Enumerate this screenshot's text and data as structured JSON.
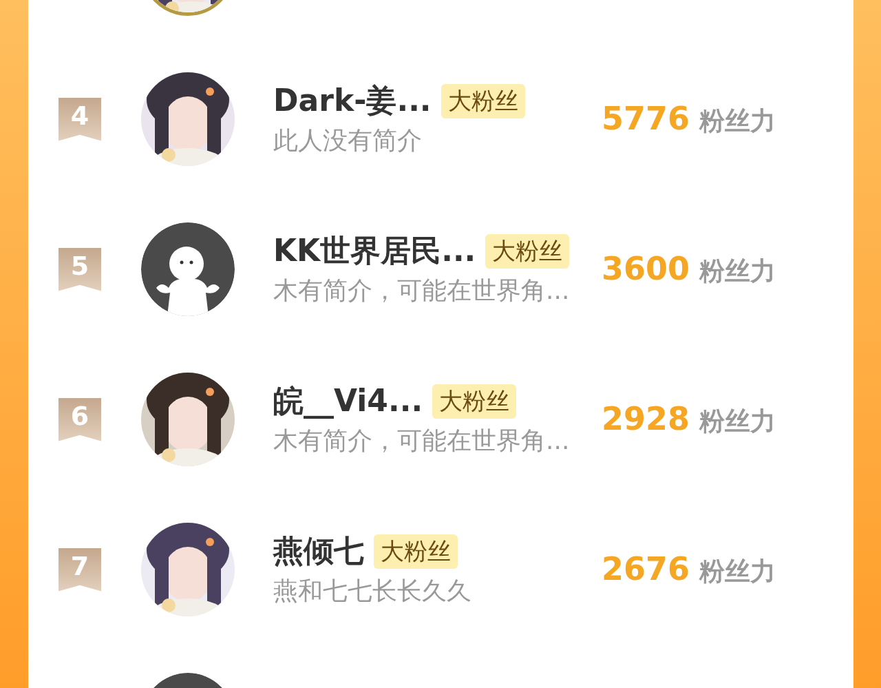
{
  "fans": [
    {
      "rank": "4",
      "name": "Dark-姜...",
      "tag": "大粉丝",
      "bio": "此人没有简介",
      "score": "5776",
      "score_unit": "粉丝力"
    },
    {
      "rank": "5",
      "name": "KK世界居民...",
      "tag": "大粉丝",
      "bio": "木有简介，可能在世界角...",
      "score": "3600",
      "score_unit": "粉丝力",
      "avatar": {
        "kind": "default"
      }
    },
    {
      "rank": "6",
      "name": "皖__Vi4...",
      "tag": "大粉丝",
      "bio": "木有简介，可能在世界角...",
      "score": "2928",
      "score_unit": "粉丝力"
    },
    {
      "rank": "7",
      "name": "燕倾七",
      "tag": "大粉丝",
      "bio": "燕和七七长长久久",
      "score": "2676",
      "score_unit": "粉丝力"
    }
  ]
}
